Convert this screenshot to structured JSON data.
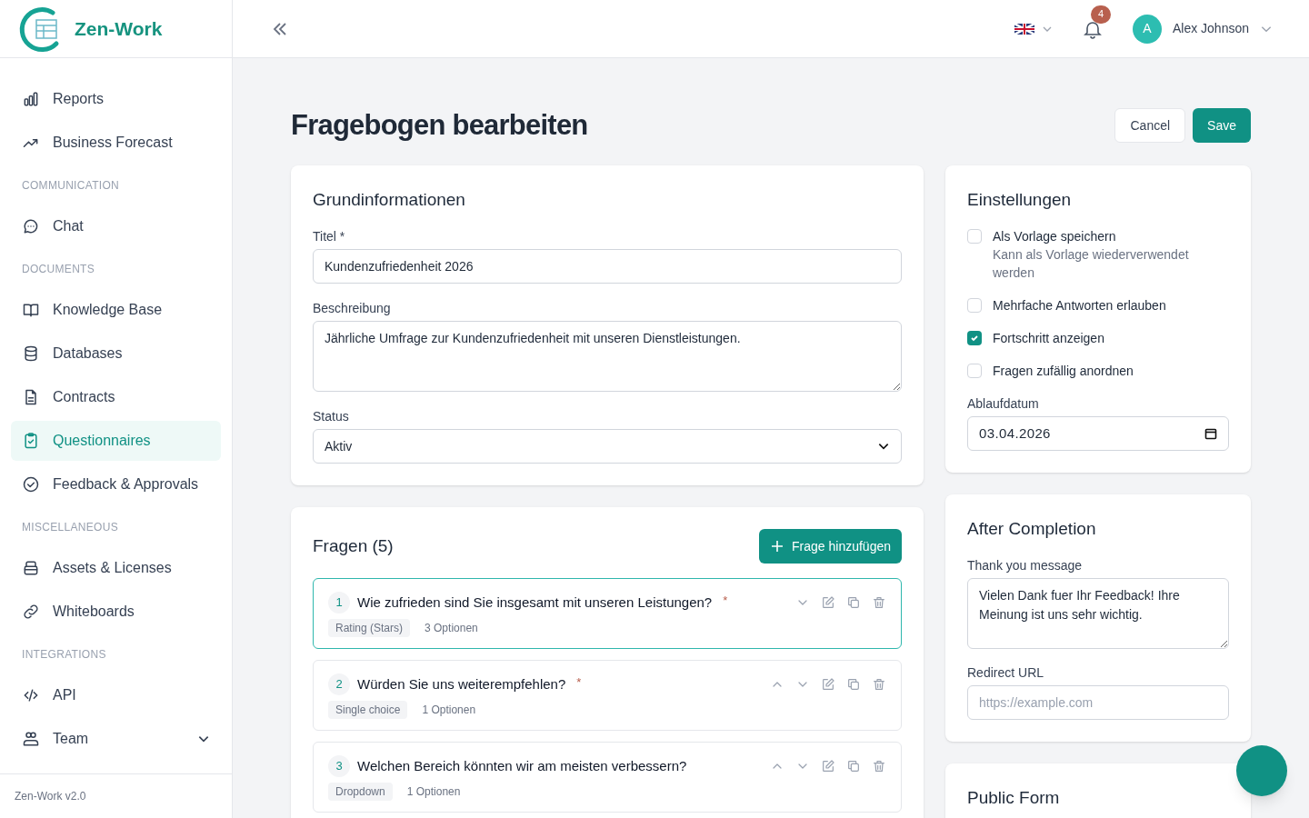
{
  "brand": {
    "name": "Zen-Work",
    "version": "Zen-Work v2.0"
  },
  "sidebar": {
    "items": [
      {
        "kind": "item",
        "label": "Reports",
        "selected": false
      },
      {
        "kind": "item",
        "label": "Business Forecast",
        "selected": false
      },
      {
        "kind": "section",
        "label": "COMMUNICATION"
      },
      {
        "kind": "item",
        "label": "Chat",
        "selected": false
      },
      {
        "kind": "section",
        "label": "DOCUMENTS"
      },
      {
        "kind": "item",
        "label": "Knowledge Base",
        "selected": false
      },
      {
        "kind": "item",
        "label": "Databases",
        "selected": false
      },
      {
        "kind": "item",
        "label": "Contracts",
        "selected": false
      },
      {
        "kind": "item",
        "label": "Questionnaires",
        "selected": true
      },
      {
        "kind": "item",
        "label": "Feedback & Approvals",
        "selected": false
      },
      {
        "kind": "section",
        "label": "MISCELLANEOUS"
      },
      {
        "kind": "item",
        "label": "Assets & Licenses",
        "selected": false
      },
      {
        "kind": "item",
        "label": "Whiteboards",
        "selected": false
      },
      {
        "kind": "section",
        "label": "INTEGRATIONS"
      },
      {
        "kind": "item",
        "label": "API",
        "selected": false
      },
      {
        "kind": "item",
        "label": "Team",
        "selected": false,
        "expandable": true
      }
    ]
  },
  "header": {
    "notifications": "4",
    "user": {
      "initial": "A",
      "name": "Alex Johnson"
    }
  },
  "page": {
    "title": "Fragebogen bearbeiten",
    "buttons": [
      "Cancel",
      "Save"
    ]
  },
  "basic": {
    "title": "Grundinformationen",
    "fields": [
      {
        "kind": "input",
        "label": "Titel *",
        "value": "Kundenzufriedenheit 2026"
      },
      {
        "kind": "textarea",
        "label": "Beschreibung",
        "value": "Jährliche Umfrage zur Kundenzufriedenheit mit unseren Dienstleistungen."
      },
      {
        "kind": "select",
        "label": "Status",
        "value": "Aktiv"
      }
    ]
  },
  "questions": {
    "title": "Fragen (5)",
    "add_button": "Frage hinzufügen",
    "items": [
      {
        "number": "1",
        "text": "Wie zufrieden sind Sie insgesamt mit unseren Leistungen?",
        "required_mark": "*",
        "type": "Rating (Stars)",
        "options": "3 Optionen",
        "selected": true,
        "can_move_up": false
      },
      {
        "number": "2",
        "text": "Würden Sie uns weiterempfehlen?",
        "required_mark": "*",
        "type": "Single choice",
        "options": "1 Optionen",
        "selected": false,
        "can_move_up": true
      },
      {
        "number": "3",
        "text": "Welchen Bereich könnten wir am meisten verbessern?",
        "type": "Dropdown",
        "options": "1 Optionen",
        "selected": false,
        "can_move_up": true
      }
    ]
  },
  "settings": {
    "title": "Einstellungen",
    "options": [
      {
        "label": "Als Vorlage speichern",
        "hint": "Kann als Vorlage wiederverwendet werden",
        "checked": false
      },
      {
        "label": "Mehrfache Antworten erlauben",
        "checked": false
      },
      {
        "label": "Fortschritt anzeigen",
        "checked": true
      },
      {
        "label": "Fragen zufällig anordnen",
        "checked": false
      }
    ],
    "date_label": "Ablaufdatum",
    "date_value": "03.04.2026"
  },
  "completion": {
    "title": "After Completion",
    "message_label": "Thank you message",
    "message": "Vielen Dank fuer Ihr Feedback! Ihre Meinung ist uns sehr wichtig.",
    "url_label": "Redirect URL",
    "url_placeholder": "https://example.com"
  },
  "public_form": {
    "title": "Public Form"
  }
}
